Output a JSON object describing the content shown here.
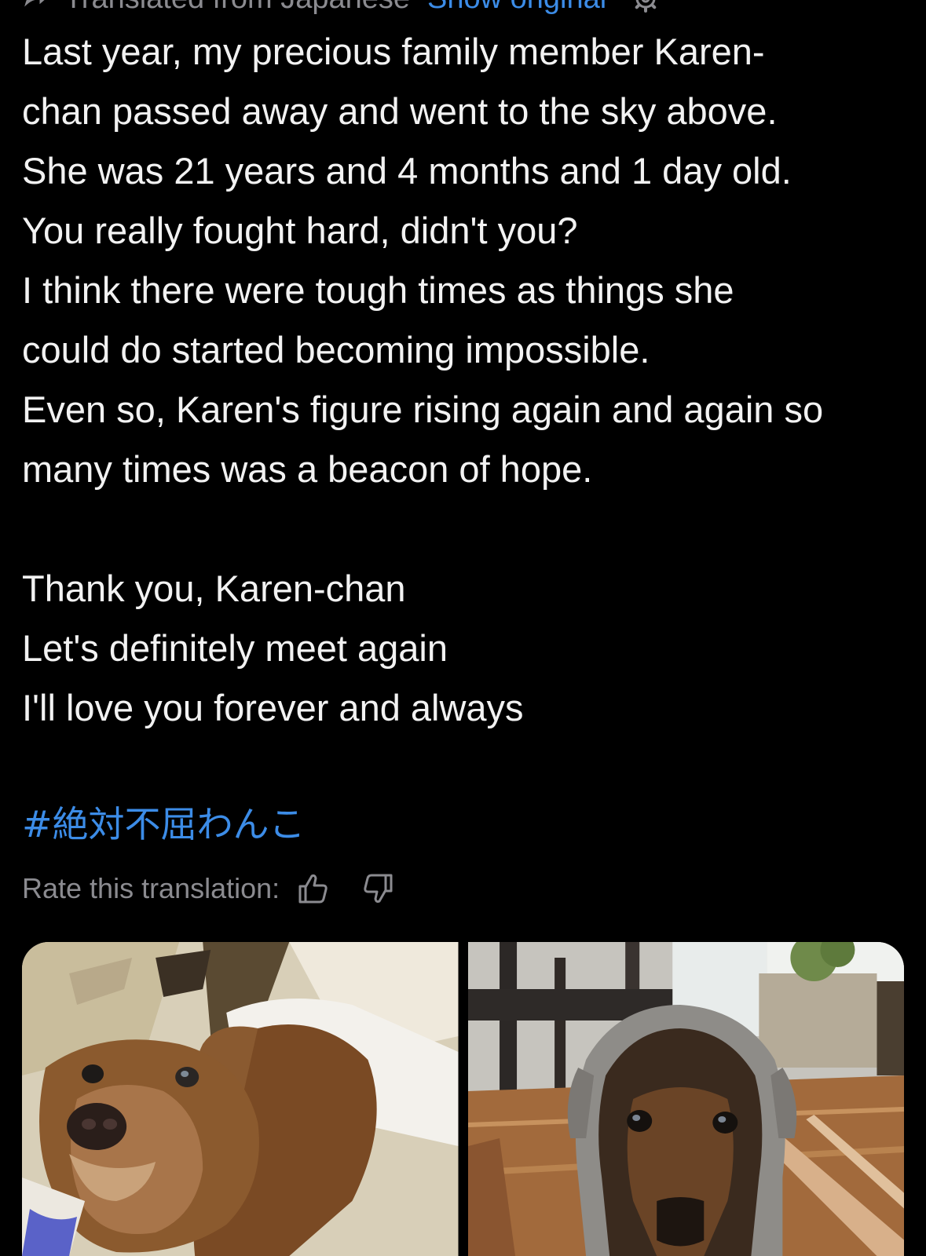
{
  "translation_bar": {
    "label": "Translated from Japanese",
    "show_original": "Show original"
  },
  "post": {
    "lines": [
      "Last year, my precious family member Karen-",
      "chan passed away and went to the sky above.",
      "She was 21 years and 4 months and 1 day old.",
      "You really fought hard, didn't you?",
      "I think there were tough times as things she",
      "could do started becoming impossible.",
      "Even so, Karen's figure rising again and again so",
      "many times was a beacon of hope.",
      "",
      "Thank you, Karen-chan",
      "Let's definitely meet again",
      "I'll love you forever and always"
    ],
    "hashtag": "#絶対不屈わんこ"
  },
  "rating": {
    "label": "Rate this translation:",
    "up_icon": "thumbs-up-icon",
    "down_icon": "thumbs-down-icon"
  },
  "photos": [
    {
      "subject": "dachshund-on-couch"
    },
    {
      "subject": "dachshund-in-hood"
    }
  ],
  "colors": {
    "background": "#000000",
    "text": "#f2f2f2",
    "muted": "#8b8b90",
    "link": "#3c8ce7"
  }
}
